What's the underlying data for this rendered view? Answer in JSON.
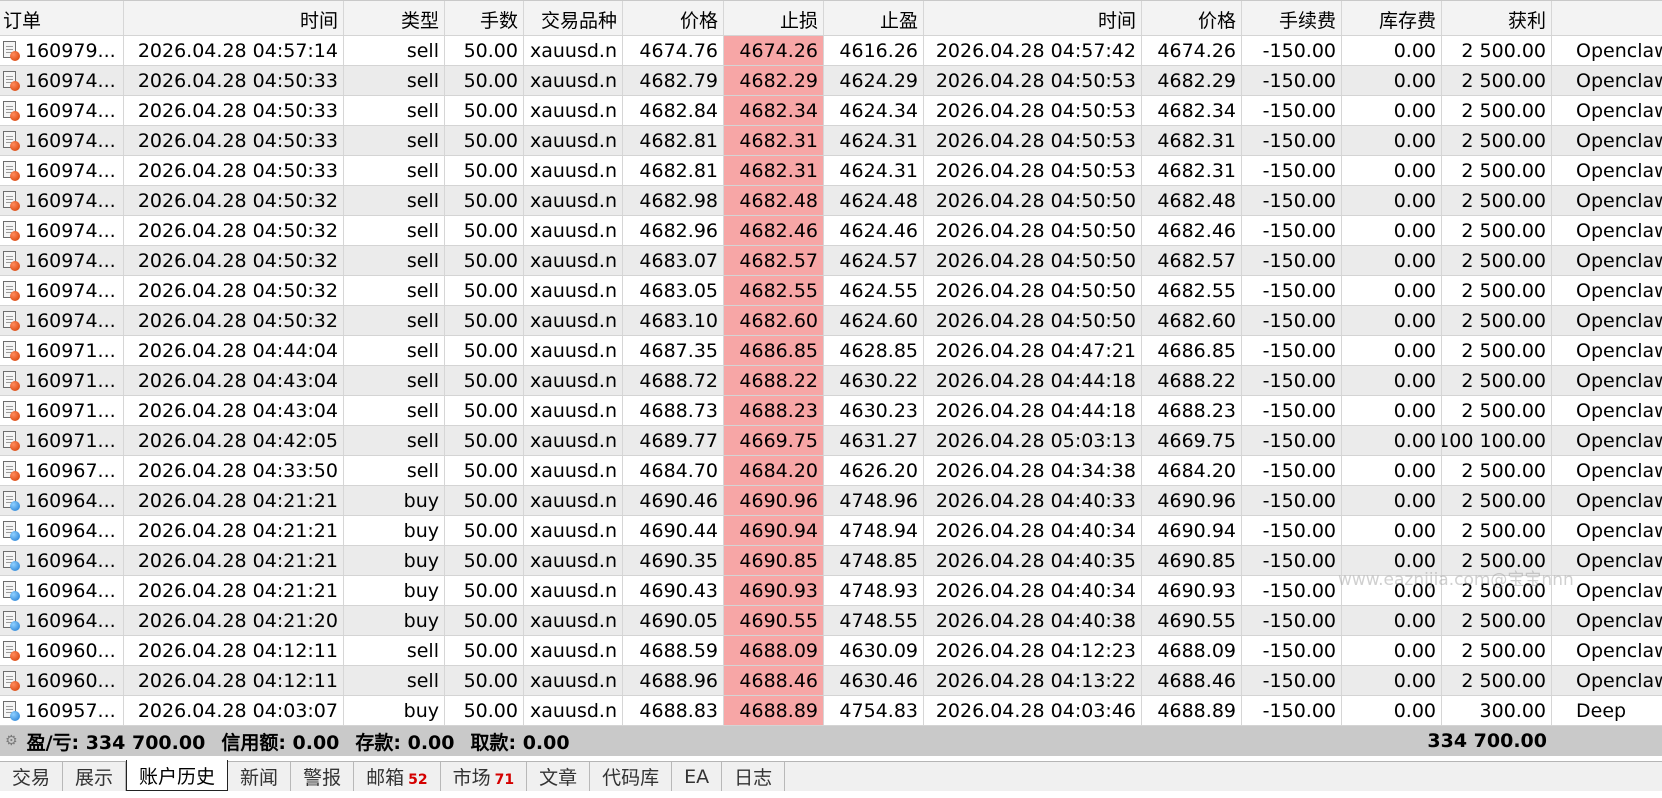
{
  "columns": [
    {
      "key": "order",
      "label": "订单",
      "width": 124,
      "align": "left"
    },
    {
      "key": "open_time",
      "label": "时间",
      "width": 220
    },
    {
      "key": "type",
      "label": "类型",
      "width": 101
    },
    {
      "key": "lots",
      "label": "手数",
      "width": 79
    },
    {
      "key": "symbol",
      "label": "交易品种",
      "width": 99
    },
    {
      "key": "open_price",
      "label": "价格",
      "width": 101
    },
    {
      "key": "sl",
      "label": "止损",
      "width": 100
    },
    {
      "key": "tp",
      "label": "止盈",
      "width": 100
    },
    {
      "key": "close_time",
      "label": "时间",
      "width": 218
    },
    {
      "key": "close_price",
      "label": "价格",
      "width": 100
    },
    {
      "key": "commission",
      "label": "手续费",
      "width": 100
    },
    {
      "key": "swap",
      "label": "库存费",
      "width": 100
    },
    {
      "key": "profit",
      "label": "获利",
      "width": 110
    },
    {
      "key": "comment",
      "label": "",
      "width": 110
    }
  ],
  "rows": [
    {
      "order": "160979...",
      "open_time": "2026.04.28 04:57:14",
      "type": "sell",
      "lots": "50.00",
      "symbol": "xauusd.n",
      "open_price": "4674.76",
      "sl": "4674.26",
      "tp": "4616.26",
      "close_time": "2026.04.28 04:57:42",
      "close_price": "4674.26",
      "commission": "-150.00",
      "swap": "0.00",
      "profit": "2 500.00",
      "comment": "Openclaw"
    },
    {
      "order": "160974...",
      "open_time": "2026.04.28 04:50:33",
      "type": "sell",
      "lots": "50.00",
      "symbol": "xauusd.n",
      "open_price": "4682.79",
      "sl": "4682.29",
      "tp": "4624.29",
      "close_time": "2026.04.28 04:50:53",
      "close_price": "4682.29",
      "commission": "-150.00",
      "swap": "0.00",
      "profit": "2 500.00",
      "comment": "Openclaw"
    },
    {
      "order": "160974...",
      "open_time": "2026.04.28 04:50:33",
      "type": "sell",
      "lots": "50.00",
      "symbol": "xauusd.n",
      "open_price": "4682.84",
      "sl": "4682.34",
      "tp": "4624.34",
      "close_time": "2026.04.28 04:50:53",
      "close_price": "4682.34",
      "commission": "-150.00",
      "swap": "0.00",
      "profit": "2 500.00",
      "comment": "Openclaw"
    },
    {
      "order": "160974...",
      "open_time": "2026.04.28 04:50:33",
      "type": "sell",
      "lots": "50.00",
      "symbol": "xauusd.n",
      "open_price": "4682.81",
      "sl": "4682.31",
      "tp": "4624.31",
      "close_time": "2026.04.28 04:50:53",
      "close_price": "4682.31",
      "commission": "-150.00",
      "swap": "0.00",
      "profit": "2 500.00",
      "comment": "Openclaw"
    },
    {
      "order": "160974...",
      "open_time": "2026.04.28 04:50:33",
      "type": "sell",
      "lots": "50.00",
      "symbol": "xauusd.n",
      "open_price": "4682.81",
      "sl": "4682.31",
      "tp": "4624.31",
      "close_time": "2026.04.28 04:50:53",
      "close_price": "4682.31",
      "commission": "-150.00",
      "swap": "0.00",
      "profit": "2 500.00",
      "comment": "Openclaw"
    },
    {
      "order": "160974...",
      "open_time": "2026.04.28 04:50:32",
      "type": "sell",
      "lots": "50.00",
      "symbol": "xauusd.n",
      "open_price": "4682.98",
      "sl": "4682.48",
      "tp": "4624.48",
      "close_time": "2026.04.28 04:50:50",
      "close_price": "4682.48",
      "commission": "-150.00",
      "swap": "0.00",
      "profit": "2 500.00",
      "comment": "Openclaw"
    },
    {
      "order": "160974...",
      "open_time": "2026.04.28 04:50:32",
      "type": "sell",
      "lots": "50.00",
      "symbol": "xauusd.n",
      "open_price": "4682.96",
      "sl": "4682.46",
      "tp": "4624.46",
      "close_time": "2026.04.28 04:50:50",
      "close_price": "4682.46",
      "commission": "-150.00",
      "swap": "0.00",
      "profit": "2 500.00",
      "comment": "Openclaw"
    },
    {
      "order": "160974...",
      "open_time": "2026.04.28 04:50:32",
      "type": "sell",
      "lots": "50.00",
      "symbol": "xauusd.n",
      "open_price": "4683.07",
      "sl": "4682.57",
      "tp": "4624.57",
      "close_time": "2026.04.28 04:50:50",
      "close_price": "4682.57",
      "commission": "-150.00",
      "swap": "0.00",
      "profit": "2 500.00",
      "comment": "Openclaw"
    },
    {
      "order": "160974...",
      "open_time": "2026.04.28 04:50:32",
      "type": "sell",
      "lots": "50.00",
      "symbol": "xauusd.n",
      "open_price": "4683.05",
      "sl": "4682.55",
      "tp": "4624.55",
      "close_time": "2026.04.28 04:50:50",
      "close_price": "4682.55",
      "commission": "-150.00",
      "swap": "0.00",
      "profit": "2 500.00",
      "comment": "Openclaw"
    },
    {
      "order": "160974...",
      "open_time": "2026.04.28 04:50:32",
      "type": "sell",
      "lots": "50.00",
      "symbol": "xauusd.n",
      "open_price": "4683.10",
      "sl": "4682.60",
      "tp": "4624.60",
      "close_time": "2026.04.28 04:50:50",
      "close_price": "4682.60",
      "commission": "-150.00",
      "swap": "0.00",
      "profit": "2 500.00",
      "comment": "Openclaw"
    },
    {
      "order": "160971...",
      "open_time": "2026.04.28 04:44:04",
      "type": "sell",
      "lots": "50.00",
      "symbol": "xauusd.n",
      "open_price": "4687.35",
      "sl": "4686.85",
      "tp": "4628.85",
      "close_time": "2026.04.28 04:47:21",
      "close_price": "4686.85",
      "commission": "-150.00",
      "swap": "0.00",
      "profit": "2 500.00",
      "comment": "Openclaw"
    },
    {
      "order": "160971...",
      "open_time": "2026.04.28 04:43:04",
      "type": "sell",
      "lots": "50.00",
      "symbol": "xauusd.n",
      "open_price": "4688.72",
      "sl": "4688.22",
      "tp": "4630.22",
      "close_time": "2026.04.28 04:44:18",
      "close_price": "4688.22",
      "commission": "-150.00",
      "swap": "0.00",
      "profit": "2 500.00",
      "comment": "Openclaw"
    },
    {
      "order": "160971...",
      "open_time": "2026.04.28 04:43:04",
      "type": "sell",
      "lots": "50.00",
      "symbol": "xauusd.n",
      "open_price": "4688.73",
      "sl": "4688.23",
      "tp": "4630.23",
      "close_time": "2026.04.28 04:44:18",
      "close_price": "4688.23",
      "commission": "-150.00",
      "swap": "0.00",
      "profit": "2 500.00",
      "comment": "Openclaw"
    },
    {
      "order": "160971...",
      "open_time": "2026.04.28 04:42:05",
      "type": "sell",
      "lots": "50.00",
      "symbol": "xauusd.n",
      "open_price": "4689.77",
      "sl": "4669.75",
      "tp": "4631.27",
      "close_time": "2026.04.28 05:03:13",
      "close_price": "4669.75",
      "commission": "-150.00",
      "swap": "0.00",
      "profit": "100 100.00",
      "comment": "Openclaw"
    },
    {
      "order": "160967...",
      "open_time": "2026.04.28 04:33:50",
      "type": "sell",
      "lots": "50.00",
      "symbol": "xauusd.n",
      "open_price": "4684.70",
      "sl": "4684.20",
      "tp": "4626.20",
      "close_time": "2026.04.28 04:34:38",
      "close_price": "4684.20",
      "commission": "-150.00",
      "swap": "0.00",
      "profit": "2 500.00",
      "comment": "Openclaw"
    },
    {
      "order": "160964...",
      "open_time": "2026.04.28 04:21:21",
      "type": "buy",
      "lots": "50.00",
      "symbol": "xauusd.n",
      "open_price": "4690.46",
      "sl": "4690.96",
      "tp": "4748.96",
      "close_time": "2026.04.28 04:40:33",
      "close_price": "4690.96",
      "commission": "-150.00",
      "swap": "0.00",
      "profit": "2 500.00",
      "comment": "Openclaw"
    },
    {
      "order": "160964...",
      "open_time": "2026.04.28 04:21:21",
      "type": "buy",
      "lots": "50.00",
      "symbol": "xauusd.n",
      "open_price": "4690.44",
      "sl": "4690.94",
      "tp": "4748.94",
      "close_time": "2026.04.28 04:40:34",
      "close_price": "4690.94",
      "commission": "-150.00",
      "swap": "0.00",
      "profit": "2 500.00",
      "comment": "Openclaw"
    },
    {
      "order": "160964...",
      "open_time": "2026.04.28 04:21:21",
      "type": "buy",
      "lots": "50.00",
      "symbol": "xauusd.n",
      "open_price": "4690.35",
      "sl": "4690.85",
      "tp": "4748.85",
      "close_time": "2026.04.28 04:40:35",
      "close_price": "4690.85",
      "commission": "-150.00",
      "swap": "0.00",
      "profit": "2 500.00",
      "comment": "Openclaw"
    },
    {
      "order": "160964...",
      "open_time": "2026.04.28 04:21:21",
      "type": "buy",
      "lots": "50.00",
      "symbol": "xauusd.n",
      "open_price": "4690.43",
      "sl": "4690.93",
      "tp": "4748.93",
      "close_time": "2026.04.28 04:40:34",
      "close_price": "4690.93",
      "commission": "-150.00",
      "swap": "0.00",
      "profit": "2 500.00",
      "comment": "Openclaw"
    },
    {
      "order": "160964...",
      "open_time": "2026.04.28 04:21:20",
      "type": "buy",
      "lots": "50.00",
      "symbol": "xauusd.n",
      "open_price": "4690.05",
      "sl": "4690.55",
      "tp": "4748.55",
      "close_time": "2026.04.28 04:40:38",
      "close_price": "4690.55",
      "commission": "-150.00",
      "swap": "0.00",
      "profit": "2 500.00",
      "comment": "Openclaw"
    },
    {
      "order": "160960...",
      "open_time": "2026.04.28 04:12:11",
      "type": "sell",
      "lots": "50.00",
      "symbol": "xauusd.n",
      "open_price": "4688.59",
      "sl": "4688.09",
      "tp": "4630.09",
      "close_time": "2026.04.28 04:12:23",
      "close_price": "4688.09",
      "commission": "-150.00",
      "swap": "0.00",
      "profit": "2 500.00",
      "comment": "Openclaw"
    },
    {
      "order": "160960...",
      "open_time": "2026.04.28 04:12:11",
      "type": "sell",
      "lots": "50.00",
      "symbol": "xauusd.n",
      "open_price": "4688.96",
      "sl": "4688.46",
      "tp": "4630.46",
      "close_time": "2026.04.28 04:13:22",
      "close_price": "4688.46",
      "commission": "-150.00",
      "swap": "0.00",
      "profit": "2 500.00",
      "comment": "Openclaw"
    },
    {
      "order": "160957...",
      "open_time": "2026.04.28 04:03:07",
      "type": "buy",
      "lots": "50.00",
      "symbol": "xauusd.n",
      "open_price": "4688.83",
      "sl": "4688.89",
      "tp": "4754.83",
      "close_time": "2026.04.28 04:03:46",
      "close_price": "4688.89",
      "commission": "-150.00",
      "swap": "0.00",
      "profit": "300.00",
      "comment": "Deep"
    }
  ],
  "colors": {
    "sl_highlight": "#f7a6a6",
    "sell_dot": "#d23a00",
    "buy_dot": "#1a78d0",
    "summary_bg": "#c9c9c9"
  },
  "summary": {
    "profit_label": "盈/亏: 334 700.00",
    "credit_label": "信用额: 0.00",
    "deposit_label": "存款: 0.00",
    "withdrawal_label": "取款: 0.00",
    "total": "334 700.00"
  },
  "tabs": [
    {
      "label": "交易",
      "badge": "",
      "active": false
    },
    {
      "label": "展示",
      "badge": "",
      "active": false
    },
    {
      "label": "账户历史",
      "badge": "",
      "active": true
    },
    {
      "label": "新闻",
      "badge": "",
      "active": false
    },
    {
      "label": "警报",
      "badge": "",
      "active": false
    },
    {
      "label": "邮箱",
      "badge": "52",
      "active": false
    },
    {
      "label": "市场",
      "badge": "71",
      "active": false
    },
    {
      "label": "文章",
      "badge": "",
      "active": false
    },
    {
      "label": "代码库",
      "badge": "",
      "active": false
    },
    {
      "label": "EA",
      "badge": "",
      "active": false
    },
    {
      "label": "日志",
      "badge": "",
      "active": false
    }
  ],
  "watermark": "www.eaznijia.com@宝宝nnn"
}
